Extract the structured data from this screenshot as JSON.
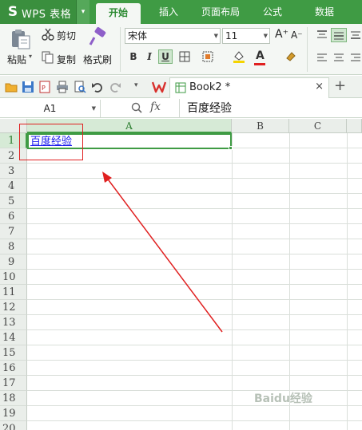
{
  "app": {
    "logo_glyph": "S",
    "name": "WPS 表格",
    "menu_arrow": "▾"
  },
  "menu_tabs": [
    {
      "label": "开始",
      "active": true
    },
    {
      "label": "插入",
      "active": false
    },
    {
      "label": "页面布局",
      "active": false
    },
    {
      "label": "公式",
      "active": false
    },
    {
      "label": "数据",
      "active": false
    }
  ],
  "ribbon": {
    "cut_label": "剪切",
    "paste_label": "粘贴",
    "paste_arrow": "▾",
    "copy_label": "复制",
    "format_painter_label": "格式刷",
    "font_name": "宋体",
    "font_size": "11",
    "bold": "B",
    "italic": "I",
    "underline": "U",
    "font_color_glyph": "A",
    "grow_font": "A⁺",
    "shrink_font": "A⁻"
  },
  "quick_access": {
    "doc_tab_name": "Book2 *",
    "close_glyph": "×",
    "add_glyph": "+",
    "dropdown_glyph": "▾"
  },
  "formula_bar": {
    "name_box": "A1",
    "fx_label": "fx",
    "formula_value": "百度经验"
  },
  "grid": {
    "columns": [
      "A",
      "B",
      "C"
    ],
    "rows": [
      "1",
      "2",
      "3",
      "4",
      "5",
      "6",
      "7",
      "8",
      "9",
      "10",
      "11",
      "12",
      "13",
      "14",
      "15",
      "16",
      "17",
      "18",
      "19",
      "20"
    ],
    "cell_a1": "百度经验"
  },
  "watermark": "Baidu经验",
  "colors": {
    "brand_green": "#3f9b44",
    "annotation_red": "#e02020",
    "hyperlink_blue": "#1a1aee"
  }
}
